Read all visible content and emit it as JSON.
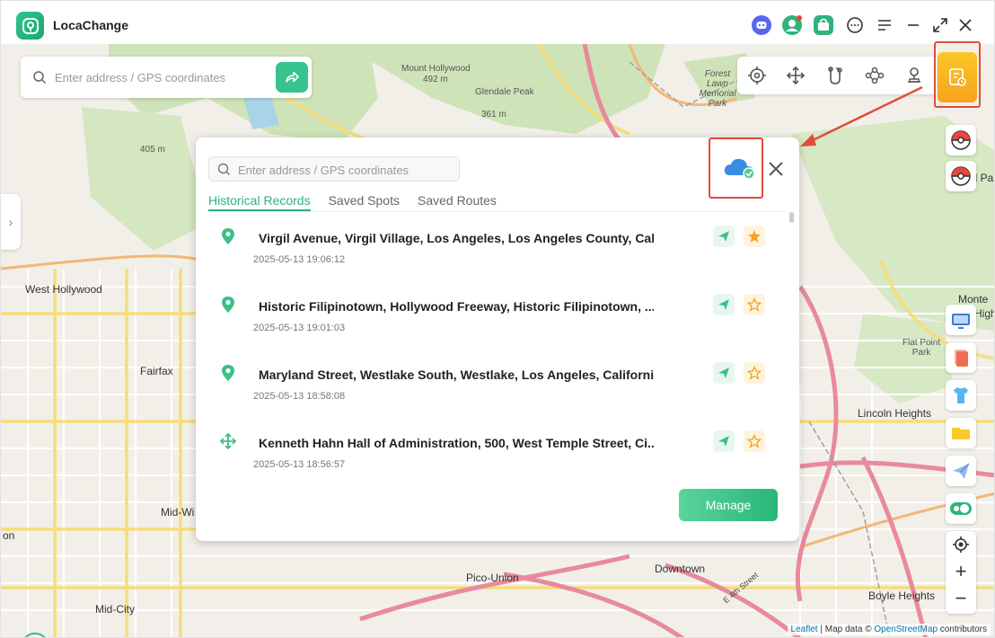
{
  "app": {
    "title": "LocaChange"
  },
  "titlebar_icons": [
    "discord-icon",
    "avatar-icon",
    "shop-icon",
    "feedback-icon",
    "menu-icon",
    "minimize-icon",
    "fullscreen-icon",
    "close-icon"
  ],
  "map_search": {
    "placeholder": "Enter address / GPS coordinates"
  },
  "mode_bar": [
    "teleport-icon",
    "joystick-icon",
    "two-spot-route-icon",
    "multi-spot-route-icon",
    "jump-teleport-icon"
  ],
  "map_labels": {
    "mount_hollywood": "Mount Hollywood",
    "mount_hollywood_elev": "492 m",
    "glendale_peak": "Glendale Peak",
    "glendale_peak_elev": "361 m",
    "forest_lawn": "Forest Lawn Memorial Park",
    "elev_405": "405 m",
    "west_hollywood": "West Hollywood",
    "fairfax": "Fairfax",
    "mid_wilshire": "Mid-Wi",
    "mid_city": "Mid-City",
    "pico_union": "Pico-Union",
    "downtown": "Downtown",
    "lincoln_heights": "Lincoln Heights",
    "boyle_heights": "Boyle Heights",
    "flat_point_park": "Flat Point Park",
    "monte": "Monte",
    "hight": "Hight",
    "highland_park": "Hi    d Pa",
    "on": "on",
    "e_4th": "E 4th Street"
  },
  "panel": {
    "search_placeholder": "Enter address / GPS coordinates",
    "tabs": [
      "Historical Records",
      "Saved Spots",
      "Saved Routes"
    ],
    "records": [
      {
        "title": "Virgil Avenue, Virgil Village, Los Angeles, Los Angeles County, Cal...",
        "time": "2025-05-13 19:06:12",
        "type": "pin",
        "favorited": true
      },
      {
        "title": "Historic Filipinotown, Hollywood Freeway, Historic Filipinotown, ...",
        "time": "2025-05-13 19:01:03",
        "type": "pin",
        "favorited": false
      },
      {
        "title": "Maryland Street, Westlake South, Westlake, Los Angeles, Californi...",
        "time": "2025-05-13 18:58:08",
        "type": "pin",
        "favorited": false
      },
      {
        "title": "Kenneth Hahn Hall of Administration, 500, West Temple Street, Ci...",
        "time": "2025-05-13 18:56:57",
        "type": "joystick",
        "favorited": false
      }
    ],
    "manage_label": "Manage"
  },
  "attribution": {
    "leaflet": "Leaflet",
    "sep": " | Map data © ",
    "osm": "OpenStreetMap",
    "contributors": " contributors"
  },
  "colors": {
    "accent": "#2db37a",
    "highlight": "#e24b3a",
    "records_btn": "#f7a21b"
  }
}
